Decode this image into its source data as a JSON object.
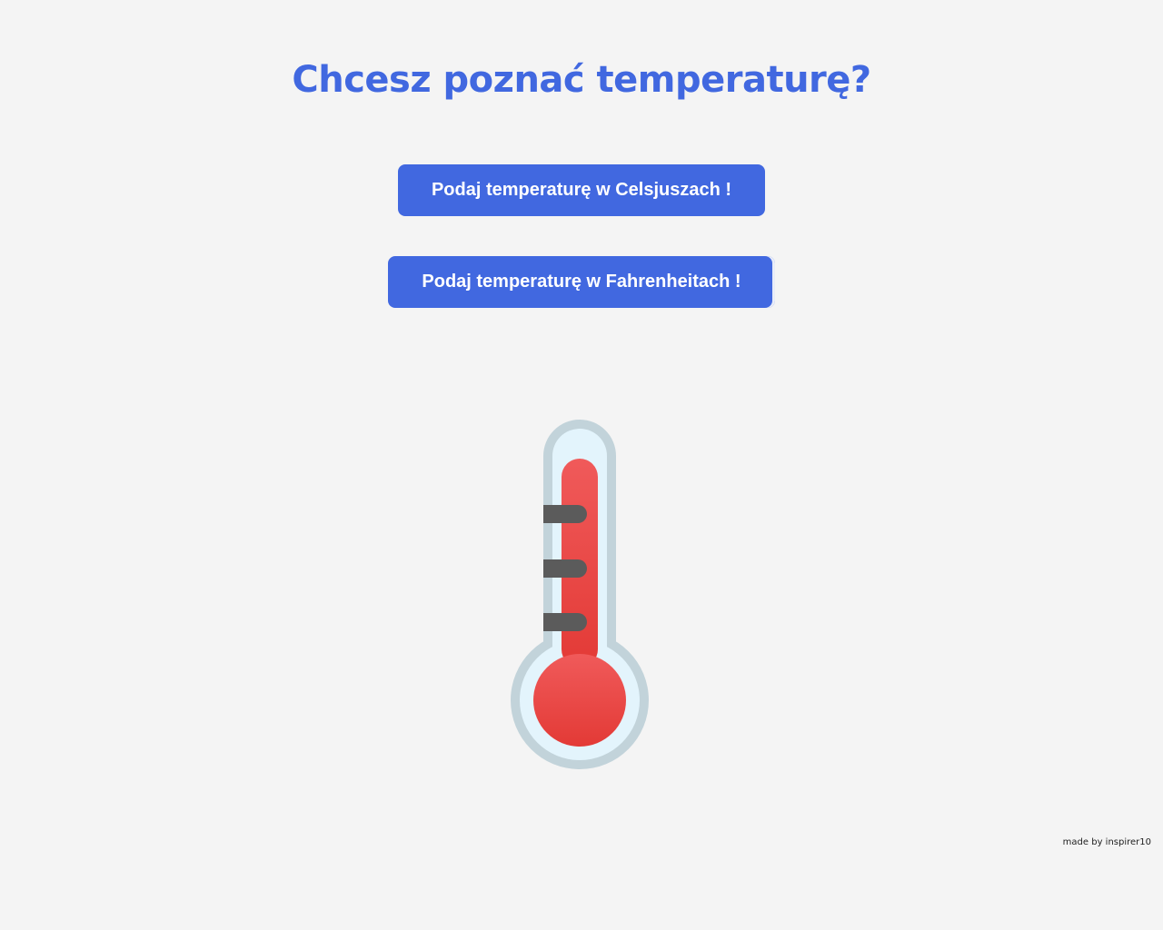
{
  "header": {
    "title": "Chcesz poznać temperaturę?"
  },
  "buttons": {
    "celsius_label": "Podaj temperaturę w Celsjuszach !",
    "fahrenheit_label": "Podaj temperaturę w Fahrenheitach !"
  },
  "illustration": {
    "icon": "thermometer-icon"
  },
  "footer": {
    "credit": "made by inspirer10"
  },
  "colors": {
    "accent": "#4168e0",
    "background": "#f4f4f4",
    "mercury": "#e53935",
    "tube_outline": "#c2d3da",
    "tube_inner": "#e3f4fc",
    "tick": "#5b5b5b"
  }
}
